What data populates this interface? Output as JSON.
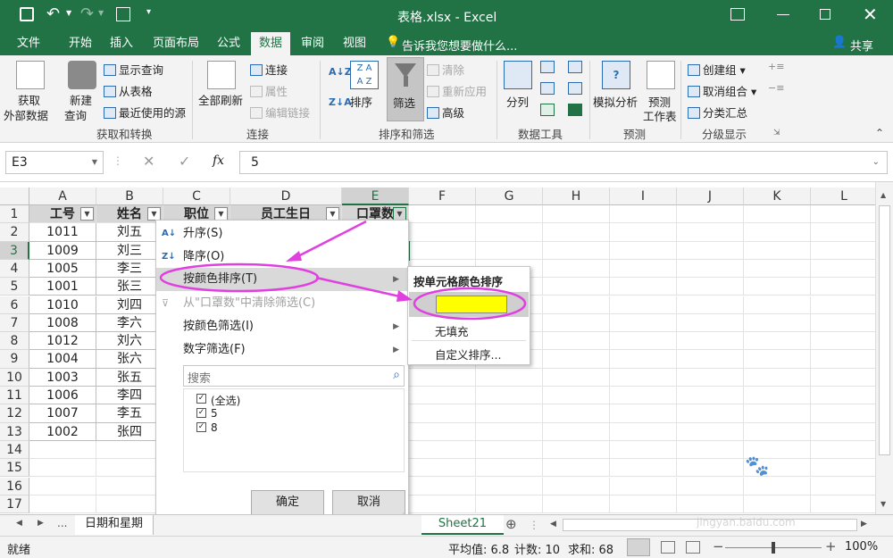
{
  "titlebar": {
    "title": "表格.xlsx - Excel"
  },
  "tabs": [
    "文件",
    "开始",
    "插入",
    "页面布局",
    "公式",
    "数据",
    "审阅",
    "视图"
  ],
  "tellme": "告诉我您想要做什么...",
  "share": "共享",
  "ribbon": {
    "get_external": [
      "获取",
      "外部数据"
    ],
    "new_query": [
      "新建",
      "查询"
    ],
    "show_queries": "显示查询",
    "from_table": "从表格",
    "recent_sources": "最近使用的源",
    "group_get": "获取和转换",
    "refresh_all": "全部刷新",
    "connections": "连接",
    "properties": "属性",
    "edit_links": "编辑链接",
    "group_conn": "连接",
    "sort": "排序",
    "filter": "筛选",
    "clear": "清除",
    "reapply": "重新应用",
    "advanced": "高级",
    "group_sort": "排序和筛选",
    "text_to_cols": "分列",
    "group_tools": "数据工具",
    "what_if": "模拟分析",
    "forecast_sheet": [
      "预测",
      "工作表"
    ],
    "group_forecast": "预测",
    "group_btn": "创建组",
    "ungroup": "取消组合",
    "subtotal": "分类汇总",
    "group_outline": "分级显示"
  },
  "formula": {
    "namebox": "E3",
    "fx": "fx",
    "value": "5"
  },
  "columns": [
    "A",
    "B",
    "C",
    "D",
    "E",
    "F",
    "G",
    "H",
    "I",
    "J",
    "K",
    "L"
  ],
  "rows": [
    "1",
    "2",
    "3",
    "4",
    "5",
    "6",
    "7",
    "8",
    "9",
    "10",
    "11",
    "12",
    "13",
    "14",
    "15",
    "16",
    "17"
  ],
  "headers": [
    "工号",
    "姓名",
    "职位",
    "员工生日",
    "口罩数"
  ],
  "table": [
    [
      "1011",
      "刘五"
    ],
    [
      "1009",
      "刘三"
    ],
    [
      "1005",
      "李三"
    ],
    [
      "1001",
      "张三"
    ],
    [
      "1010",
      "刘四"
    ],
    [
      "1008",
      "李六"
    ],
    [
      "1012",
      "刘六"
    ],
    [
      "1004",
      "张六"
    ],
    [
      "1003",
      "张五"
    ],
    [
      "1006",
      "李四"
    ],
    [
      "1007",
      "李五"
    ],
    [
      "1002",
      "张四"
    ]
  ],
  "menu": {
    "asc": "升序(S)",
    "desc": "降序(O)",
    "sort_color": "按颜色排序(T)",
    "clear_filter": "从\"口罩数\"中清除筛选(C)",
    "filter_color": "按颜色筛选(I)",
    "number_filter": "数字筛选(F)",
    "search_placeholder": "搜索",
    "list": [
      "(全选)",
      "5",
      "8"
    ],
    "ok": "确定",
    "cancel": "取消"
  },
  "submenu": {
    "title": "按单元格颜色排序",
    "highlight_color": "#FFFF00",
    "no_fill": "无填充",
    "custom": "自定义排序..."
  },
  "sheets": {
    "left": "日期和星期",
    "active": "Sheet21"
  },
  "status": {
    "ready": "就绪",
    "average": "平均值: 6.8",
    "count": "计数: 10",
    "sum": "求和: 68",
    "zoom": "100%"
  },
  "watermark": {
    "site": "jingyan.baidu.com"
  },
  "colors": {
    "excel_green": "#217346",
    "annotation": "#e040e0"
  }
}
